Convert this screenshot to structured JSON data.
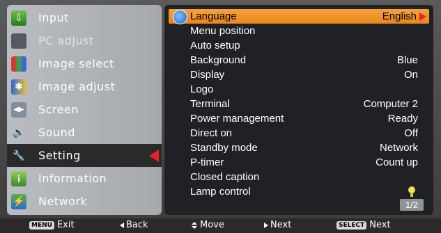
{
  "left_menu": {
    "items": [
      {
        "label": "Input",
        "icon": "input-icon"
      },
      {
        "label": "PC adjust",
        "icon": "pc-adjust-icon"
      },
      {
        "label": "Image select",
        "icon": "image-select-icon"
      },
      {
        "label": "Image adjust",
        "icon": "image-adjust-icon"
      },
      {
        "label": "Screen",
        "icon": "screen-icon"
      },
      {
        "label": "Sound",
        "icon": "sound-icon"
      },
      {
        "label": "Setting",
        "icon": "setting-icon"
      },
      {
        "label": "Information",
        "icon": "information-icon"
      },
      {
        "label": "Network",
        "icon": "network-icon"
      }
    ],
    "active_index": 6
  },
  "settings": {
    "rows": [
      {
        "name": "Language",
        "value": "English"
      },
      {
        "name": "Menu position",
        "value": ""
      },
      {
        "name": "Auto setup",
        "value": ""
      },
      {
        "name": "Background",
        "value": "Blue"
      },
      {
        "name": "Display",
        "value": "On"
      },
      {
        "name": "Logo",
        "value": ""
      },
      {
        "name": "Terminal",
        "value": "Computer 2"
      },
      {
        "name": "Power management",
        "value": "Ready"
      },
      {
        "name": "Direct on",
        "value": "Off"
      },
      {
        "name": "Standby mode",
        "value": "Network"
      },
      {
        "name": "P-timer",
        "value": "Count up"
      },
      {
        "name": "Closed caption",
        "value": ""
      },
      {
        "name": "Lamp control",
        "value": ""
      }
    ],
    "selected_index": 0,
    "page_indicator": "1/2"
  },
  "bottom_bar": {
    "exit_key": "MENU",
    "exit_label": "Exit",
    "back_label": "Back",
    "move_label": "Move",
    "next_label": "Next",
    "select_key": "SELECT",
    "select_next_label": "Next"
  },
  "colors": {
    "accent": "#e8861a",
    "arrow_red": "#e8202a",
    "panel_dark": "#1f2124"
  }
}
